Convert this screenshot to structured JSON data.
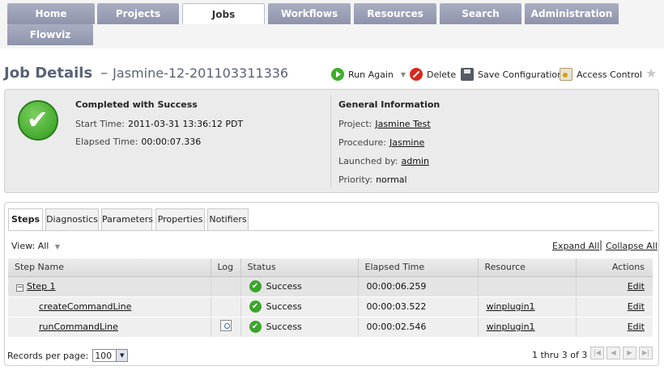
{
  "nav": {
    "tabs": [
      "Home",
      "Projects",
      "Jobs",
      "Workflows",
      "Resources",
      "Search",
      "Administration",
      "Flowviz"
    ],
    "active": "Jobs"
  },
  "header": {
    "title": "Job Details",
    "dash": "–",
    "job_name": "Jasmine-12-201103311336"
  },
  "actions": {
    "run_again": "Run Again",
    "delete": "Delete",
    "save_config": "Save Configuration",
    "access_control": "Access Control"
  },
  "summary": {
    "status_title": "Completed with Success",
    "start_time_label": "Start Time:",
    "start_time": "2011-03-31 13:36:12 PDT",
    "elapsed_label": "Elapsed Time:",
    "elapsed": "00:00:07.336",
    "general_title": "General Information",
    "project_label": "Project:",
    "project": "Jasmine Test",
    "procedure_label": "Procedure:",
    "procedure": "Jasmine",
    "launched_label": "Launched by:",
    "launched_by": "admin",
    "priority_label": "Priority:",
    "priority": "normal"
  },
  "subtabs": [
    "Steps",
    "Diagnostics",
    "Parameters",
    "Properties",
    "Notifiers"
  ],
  "view": {
    "label": "View:",
    "value": "All",
    "expand_all": "Expand All",
    "separator": "|",
    "collapse_all": "Collapse All"
  },
  "table": {
    "headers": [
      "Step Name",
      "Log",
      "Status",
      "Elapsed Time",
      "Resource",
      "Actions"
    ],
    "rows": [
      {
        "name": "Step 1",
        "status": "Success",
        "elapsed": "00:00:06.259",
        "resource": "",
        "action": "Edit"
      },
      {
        "name": "createCommandLine",
        "status": "Success",
        "elapsed": "00:00:03.522",
        "resource": "winplugin1",
        "action": "Edit"
      },
      {
        "name": "runCommandLine",
        "status": "Success",
        "elapsed": "00:00:02.546",
        "resource": "winplugin1",
        "action": "Edit"
      }
    ]
  },
  "footer": {
    "records_label": "Records per page:",
    "records_value": "100",
    "page_info": "1 thru 3 of 3"
  }
}
